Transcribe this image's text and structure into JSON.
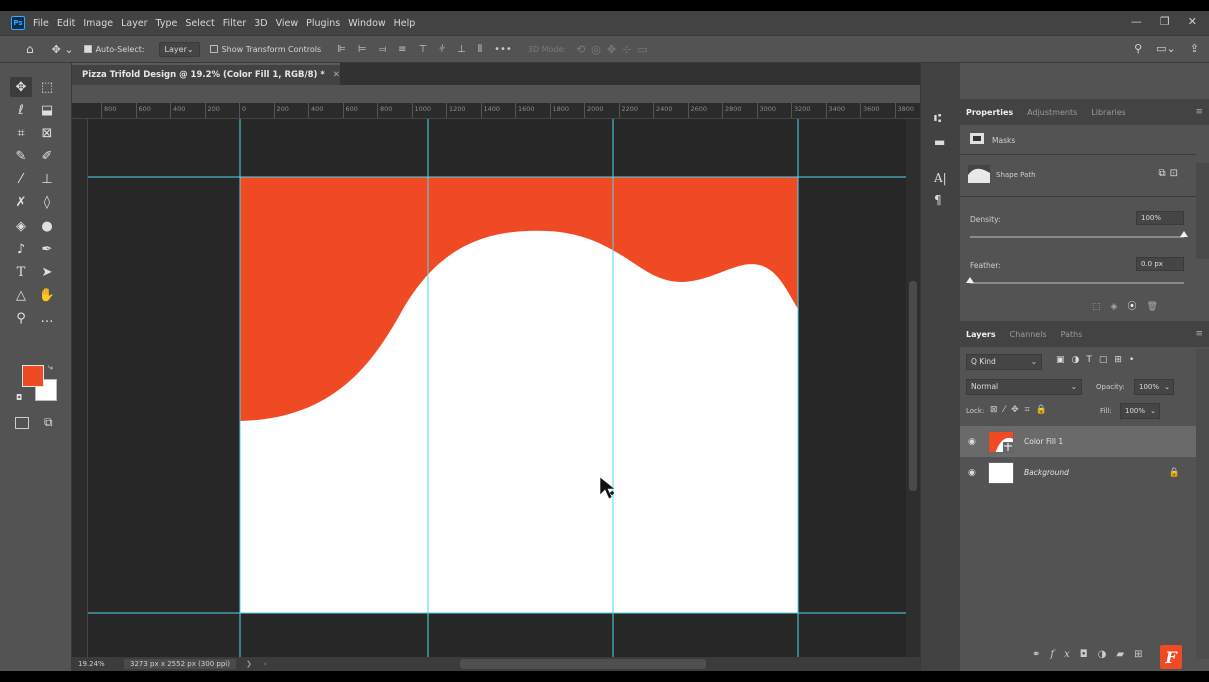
{
  "menu": [
    "File",
    "Edit",
    "Image",
    "Layer",
    "Type",
    "Select",
    "Filter",
    "3D",
    "View",
    "Plugins",
    "Window",
    "Help"
  ],
  "options": {
    "auto_select_label": "Auto-Select:",
    "auto_select_target": "Layer",
    "show_transform_label": "Show Transform Controls",
    "more": "•••",
    "mode_label": "3D Mode:"
  },
  "document": {
    "tab_title": "Pizza Trifold Design @ 19.2% (Color Fill 1, RGB/8) *",
    "zoom": "19.24%",
    "size": "3273 px x 2552 px (300 ppi)",
    "ruler_ticks": [
      "800",
      "600",
      "400",
      "200",
      "0",
      "200",
      "400",
      "600",
      "800",
      "1000",
      "1200",
      "1400",
      "1600",
      "1800",
      "2000",
      "2200",
      "2400",
      "2600",
      "2800",
      "3000",
      "3200",
      "3400",
      "3600",
      "3800"
    ]
  },
  "properties": {
    "tabs": [
      "Properties",
      "Adjustments",
      "Libraries"
    ],
    "masks_label": "Masks",
    "shape_path_label": "Shape Path",
    "density_label": "Density:",
    "density_value": "100%",
    "density": 1.0,
    "feather_label": "Feather:",
    "feather_value": "0.0 px",
    "feather": 0.0
  },
  "layers": {
    "tabs": [
      "Layers",
      "Channels",
      "Paths"
    ],
    "filter_label": "Q Kind",
    "blend_mode": "Normal",
    "opacity_label": "Opacity:",
    "opacity_value": "100%",
    "lock_label": "Lock:",
    "fill_label": "Fill:",
    "fill_value": "100%",
    "items": [
      {
        "name": "Color Fill 1",
        "selected": true
      },
      {
        "name": "Background",
        "selected": false
      }
    ]
  },
  "colors": {
    "foreground": "#f04a25",
    "background": "#ffffff",
    "guide": "#4fd8e6"
  },
  "watermark": "F"
}
